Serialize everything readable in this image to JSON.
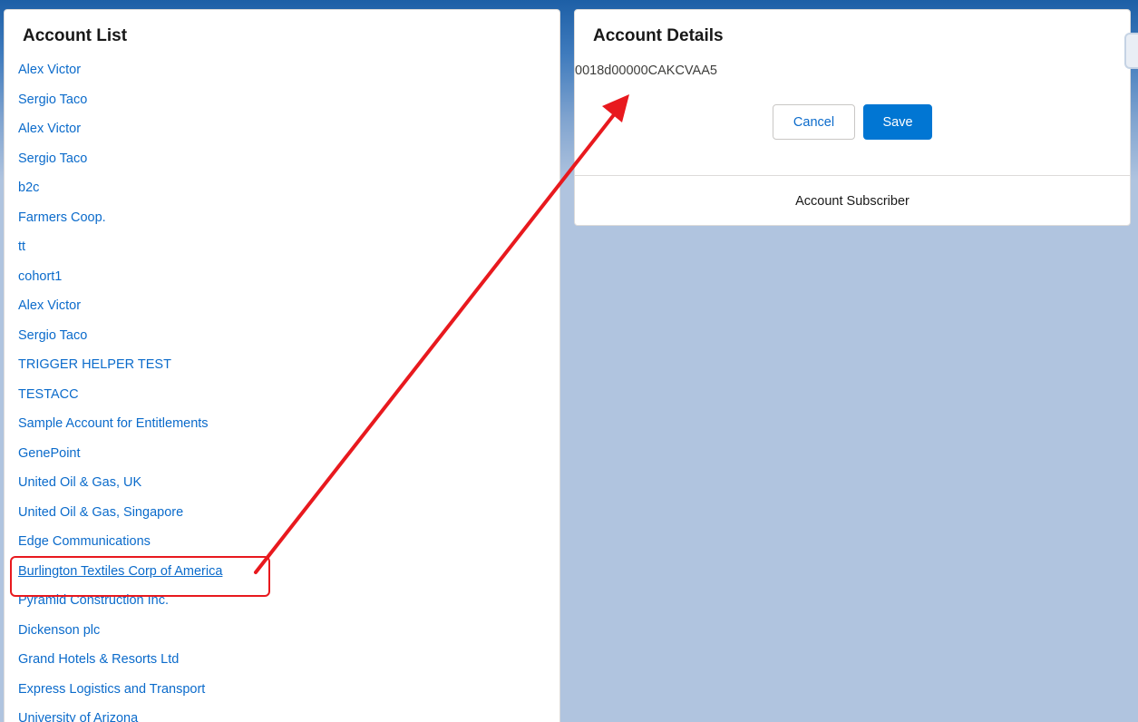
{
  "account_list": {
    "title": "Account List",
    "items": [
      "Alex Victor",
      "Sergio Taco",
      "Alex Victor",
      "Sergio Taco",
      "b2c",
      "Farmers Coop.",
      "tt",
      "cohort1",
      "Alex Victor",
      "Sergio Taco",
      "TRIGGER HELPER TEST",
      "TESTACC",
      "Sample Account for Entitlements",
      "GenePoint",
      "United Oil & Gas, UK",
      "United Oil & Gas, Singapore",
      "Edge Communications",
      "Burlington Textiles Corp of America",
      "Pyramid Construction Inc.",
      "Dickenson plc",
      "Grand Hotels & Resorts Ltd",
      "Express Logistics and Transport",
      "University of Arizona"
    ],
    "highlighted_item": "Burlington Textiles Corp of America"
  },
  "account_details": {
    "title": "Account Details",
    "record_id": "0018d00000CAKCVAA5",
    "cancel_label": "Cancel",
    "save_label": "Save",
    "footer_text": "Account Subscriber"
  },
  "colors": {
    "link": "#0b6bcb",
    "brand_button": "#0176d3",
    "annotation": "#e8191e",
    "page_background": "#b0c4df"
  }
}
